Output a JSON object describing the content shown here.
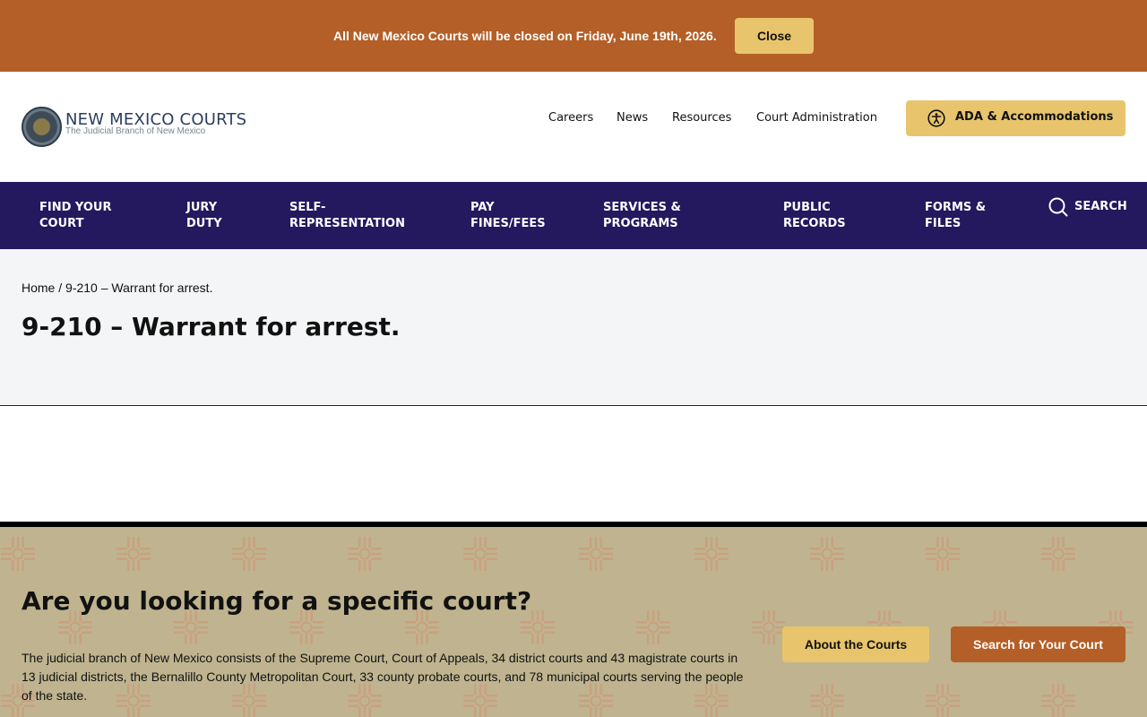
{
  "alert": {
    "message": "All New Mexico Courts will be closed on Friday, June 19th, 2026.",
    "close_label": "Close"
  },
  "header": {
    "logo_title": "NEW MEXICO COURTS",
    "logo_subtitle": "The Judicial Branch of New Mexico",
    "utility_links": [
      "Careers",
      "News",
      "Resources",
      "Court Administration"
    ],
    "ada_label": "ADA & Accommodations"
  },
  "main_nav": {
    "items": [
      {
        "line1": "FIND YOUR",
        "line2": "COURT"
      },
      {
        "line1": "JURY",
        "line2": "DUTY"
      },
      {
        "line1": "SELF-",
        "line2": "REPRESENTATION"
      },
      {
        "line1": "PAY",
        "line2": "FINES/FEES"
      },
      {
        "line1": "SERVICES &",
        "line2": "PROGRAMS"
      },
      {
        "line1": "PUBLIC",
        "line2": "RECORDS"
      },
      {
        "line1": "FORMS &",
        "line2": "FILES"
      }
    ],
    "search_label": "SEARCH"
  },
  "page": {
    "breadcrumb_home": "Home",
    "breadcrumb_separator": " / ",
    "breadcrumb_current": "9-210 – Warrant for arrest.",
    "title": "9-210 – Warrant for arrest."
  },
  "cta": {
    "title": "Are you looking for a specific court?",
    "body": "The judicial branch of New Mexico consists of the Supreme Court, Court of Appeals, 34 district courts and 43 magistrate courts in 13 judicial districts, the Bernalillo County Metropolitan Court, 33 county probate courts, and 78 municipal courts serving the people of the state.",
    "about_label": "About the Courts",
    "search_label": "Search for Your Court"
  },
  "colors": {
    "alert_bg": "#b45f27",
    "gold": "#e8c56c",
    "nav_bg": "#24185f",
    "hero_bg": "#f4f5f7",
    "cta_bg": "#bfb48f",
    "zia_pattern": "#c9a180"
  }
}
